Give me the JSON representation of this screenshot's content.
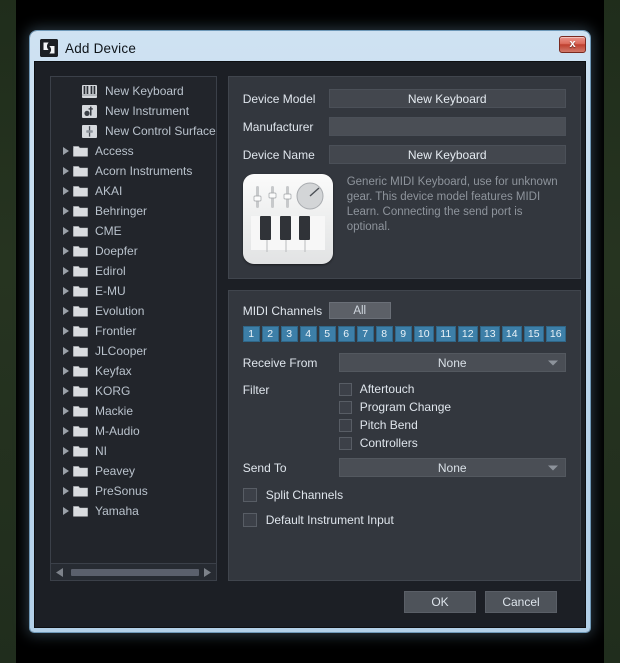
{
  "window": {
    "title": "Add Device",
    "icon": "add-device-icon",
    "close_label": "x"
  },
  "tree": {
    "leaf_items": [
      {
        "label": "New Keyboard",
        "icon": "keyboard-icon"
      },
      {
        "label": "New Instrument",
        "icon": "instrument-icon"
      },
      {
        "label": "New Control Surface",
        "icon": "control-surface-icon"
      }
    ],
    "folders": [
      {
        "label": "Access"
      },
      {
        "label": "Acorn Instruments"
      },
      {
        "label": "AKAI"
      },
      {
        "label": "Behringer"
      },
      {
        "label": "CME"
      },
      {
        "label": "Doepfer"
      },
      {
        "label": "Edirol"
      },
      {
        "label": "E-MU"
      },
      {
        "label": "Evolution"
      },
      {
        "label": "Frontier"
      },
      {
        "label": "JLCooper"
      },
      {
        "label": "Keyfax"
      },
      {
        "label": "KORG"
      },
      {
        "label": "Mackie"
      },
      {
        "label": "M-Audio"
      },
      {
        "label": "NI"
      },
      {
        "label": "Peavey"
      },
      {
        "label": "PreSonus"
      },
      {
        "label": "Yamaha"
      }
    ]
  },
  "device": {
    "model_label": "Device Model",
    "model_value": "New Keyboard",
    "manufacturer_label": "Manufacturer",
    "manufacturer_value": "",
    "name_label": "Device Name",
    "name_value": "New Keyboard",
    "description": "Generic MIDI Keyboard, use for unknown gear. This device model features MIDI Learn. Connecting the send port is optional.",
    "image_icon": "midi-keyboard-device-image"
  },
  "midi": {
    "channels_label": "MIDI Channels",
    "all_label": "All",
    "channels": [
      "1",
      "2",
      "3",
      "4",
      "5",
      "6",
      "7",
      "8",
      "9",
      "10",
      "11",
      "12",
      "13",
      "14",
      "15",
      "16"
    ],
    "channel_active_color": "#3d7fa8",
    "receive_from_label": "Receive From",
    "receive_from_value": "None",
    "filter_label": "Filter",
    "filters": [
      {
        "label": "Aftertouch",
        "checked": false
      },
      {
        "label": "Program Change",
        "checked": false
      },
      {
        "label": "Pitch Bend",
        "checked": false
      },
      {
        "label": "Controllers",
        "checked": false
      }
    ],
    "send_to_label": "Send To",
    "send_to_value": "None",
    "options": [
      {
        "label": "Split Channels",
        "checked": false
      },
      {
        "label": "Default Instrument Input",
        "checked": false
      }
    ]
  },
  "footer": {
    "ok_label": "OK",
    "cancel_label": "Cancel"
  },
  "scrollbar": {
    "left_arrow": "arrow-left-icon",
    "right_arrow": "arrow-right-icon"
  }
}
